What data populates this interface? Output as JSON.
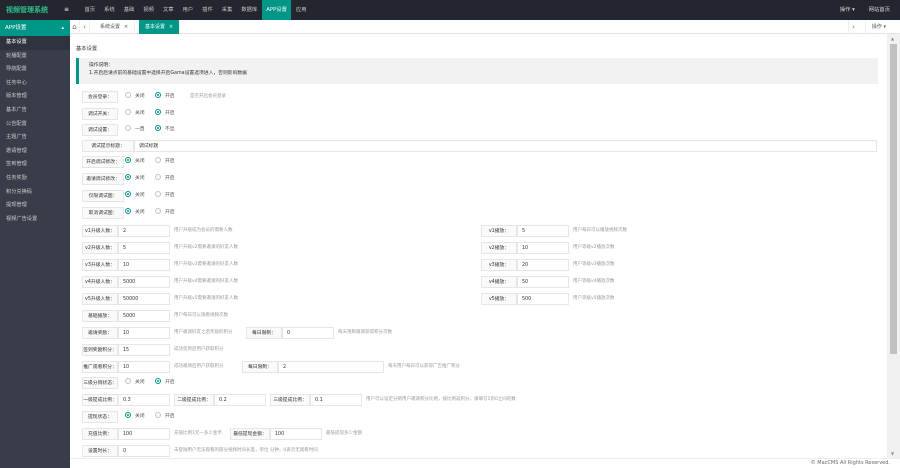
{
  "header": {
    "logo": "视频管理系统",
    "toggle_icon": "menu-fold-icon",
    "nav": [
      "首页",
      "系统",
      "基础",
      "视频",
      "文章",
      "用户",
      "插件",
      "采集",
      "数据库",
      "APP设置",
      "应用"
    ],
    "active_nav": "APP设置",
    "right": [
      "操作 ▾",
      "网站首页"
    ]
  },
  "sidebar": {
    "head": "APP设置",
    "items": [
      "基本设置",
      "轮播配置",
      "导航配置",
      "任务中心",
      "版本管理",
      "基本广告",
      "公告配置",
      "主题广告",
      "邀请管理",
      "签到管理",
      "任务奖励",
      "积分兑换码",
      "提现管理",
      "视频广告设置"
    ]
  },
  "tabs": [
    {
      "label": "系统设置"
    },
    {
      "label": "基本设置",
      "active": true
    }
  ],
  "tabbar": {
    "close_all": "操作 ▾"
  },
  "page": {
    "title": "基本设置",
    "tip_title": "操作说明：",
    "tip_text": "1.开启后请点前的基础设置中选择开启Gama设置选项进入，否则影响数据"
  },
  "rows": {
    "member": {
      "label": "会员登录：",
      "opt1": "关闭",
      "opt2": "开启",
      "hint": "是否开启会员登录"
    },
    "debug": {
      "label": "调试开关：",
      "opt1": "关闭",
      "opt2": "开启"
    },
    "limit": {
      "label": "调试设置：",
      "opt1": "一直",
      "opt2": "不显"
    },
    "debug_title": {
      "label": "调试提示标题：",
      "value": "调试标题"
    },
    "splash": {
      "label": "开启调试修改：",
      "opt1": "关闭",
      "opt2": "开启"
    },
    "reg": {
      "label": "邀请调试修改：",
      "opt1": "关闭",
      "opt2": "开启"
    },
    "v_tip": {
      "label": "仅限调试图：",
      "opt1": "关闭",
      "opt2": "开启"
    },
    "lock": {
      "label": "取消调试图：",
      "opt1": "关闭",
      "opt2": "开启"
    }
  },
  "levels": [
    {
      "label": "v1升级人数：",
      "value": "2",
      "hint": "用户升级成为会员的需要人数",
      "rlabel": "v1播放：",
      "rvalue": "5",
      "rhint": "用户每日可以播放视频次数"
    },
    {
      "label": "v2升级人数：",
      "value": "5",
      "hint": "用户升级v2需要邀请的好友人数",
      "rlabel": "v2播放：",
      "rvalue": "10",
      "rhint": "用户等级v2播放次数"
    },
    {
      "label": "v3升级人数：",
      "value": "10",
      "hint": "用户升级v3需要邀请的好友人数",
      "rlabel": "v3播放：",
      "rvalue": "20",
      "rhint": "用户等级v3播放次数"
    },
    {
      "label": "v4升级人数：",
      "value": "5000",
      "hint": "用户升级v4需要邀请的好友人数",
      "rlabel": "v4播放：",
      "rvalue": "50",
      "rhint": "用户等级v4播放次数"
    },
    {
      "label": "v5升级人数：",
      "value": "50000",
      "hint": "用户升级v5需要邀请的好友人数",
      "rlabel": "v5播放：",
      "rvalue": "500",
      "rhint": "用户等级v5播放次数"
    }
  ],
  "extra": {
    "base_play": {
      "label": "基础播放：",
      "value": "5000",
      "hint": "用户每日可以观看视频次数"
    },
    "invite_reward": {
      "label": "邀请奖励：",
      "value": "10",
      "hint": "用户邀请好友之后奖励的积分",
      "mlabel": "每日限制：",
      "mvalue": "0",
      "mhint": "每天限制邀请获得积分次数"
    },
    "sign_reward": {
      "label": "签到奖励积分：",
      "value": "15",
      "hint": "成功签到后用户获取积分"
    },
    "view_reward": {
      "label": "推广观看积分：",
      "value": "10",
      "hint": "成功邀请后用户获取积分",
      "mlabel": "每日限制：",
      "mvalue": "2",
      "mhint": "每天用户每日可以获得广告推广积分"
    },
    "three_level": {
      "label": "三级分销状态：",
      "opt1": "关闭",
      "opt2": "开启"
    },
    "rates": {
      "label": "一级提成比例：",
      "value": "0.3",
      "l2": "二级提成比例：",
      "v2": "0.2",
      "l3": "三级提成比例：",
      "v3": "0.1",
      "hint": "用户可以设定分销用户邀请积分比例，按比例返积分，请填写1到0之间的数"
    },
    "withdraw": {
      "label": "提现状态：",
      "opt1": "关闭",
      "opt2": "开启"
    },
    "ratio": {
      "label": "充值比例：",
      "value": "100",
      "hint": "充值比例1元一多少金币",
      "mlabel": "最低提现金额：",
      "mvalue": "100",
      "mhint": "最低提现多少金额"
    },
    "limit_time": {
      "label": "设置时长：",
      "value": "0",
      "hint": "未登陆用户无法观看的部分视频时间长度，单位 分钟，0表示无观看时间"
    }
  },
  "footer": "© MacCMS All Rights Reserved."
}
